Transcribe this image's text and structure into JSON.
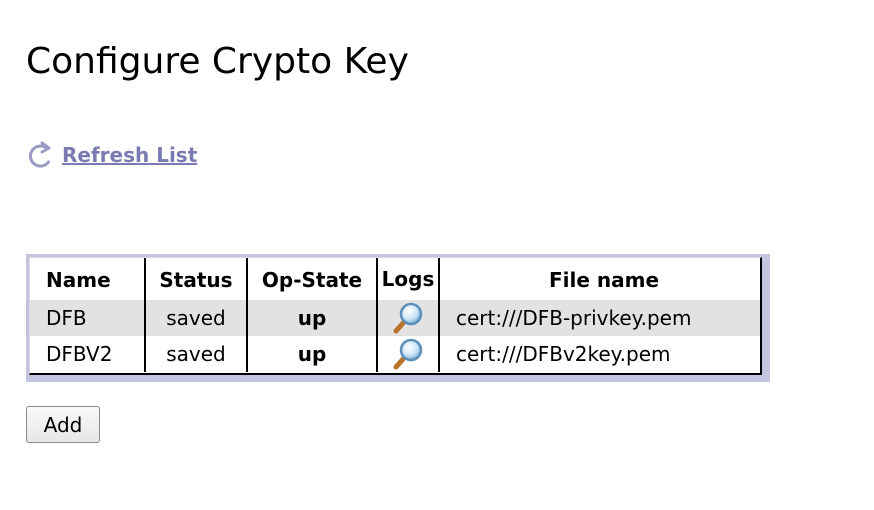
{
  "page": {
    "title": "Configure Crypto Key"
  },
  "refresh": {
    "label": "Refresh List",
    "icon": "refresh-icon"
  },
  "table": {
    "headers": {
      "name": "Name",
      "status": "Status",
      "op_state": "Op-State",
      "logs": "Logs",
      "file_name": "File name"
    },
    "rows": [
      {
        "name": "DFB",
        "status": "saved",
        "op_state": "up",
        "logs_icon": "magnifier-icon",
        "file_name": "cert:///DFB-privkey.pem"
      },
      {
        "name": "DFBV2",
        "status": "saved",
        "op_state": "up",
        "logs_icon": "magnifier-icon",
        "file_name": "cert:///DFBv2key.pem"
      }
    ]
  },
  "actions": {
    "add_label": "Add"
  },
  "colors": {
    "link": "#7a7ab2",
    "table_frame": "#c4c4de",
    "alt_row": "#e2e2e2"
  }
}
